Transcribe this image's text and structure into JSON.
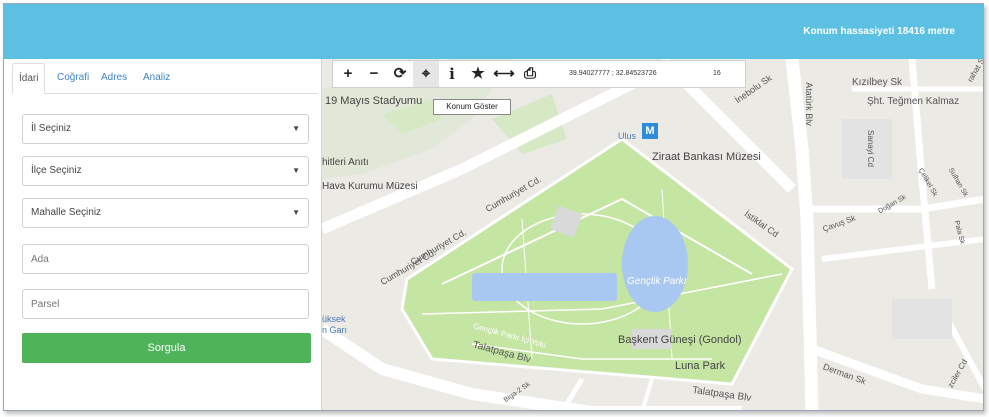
{
  "header": {
    "precision_text": "Konum hassasiyeti 18416 metre"
  },
  "tabs": [
    {
      "label": "İdari",
      "active": true
    },
    {
      "label": "Coğrafi"
    },
    {
      "label": "Adres"
    },
    {
      "label": "Analiz"
    }
  ],
  "form": {
    "province": "İl Seçiniz",
    "district": "İlçe Seçiniz",
    "neighborhood": "Mahalle Seçiniz",
    "block_placeholder": "Ada",
    "parcel_placeholder": "Parsel",
    "query_button": "Sorgula"
  },
  "toolbar": {
    "zoom_in": "+",
    "zoom_out": "−",
    "refresh": "⟳",
    "locate": "⌖",
    "info": "i",
    "favorite": "★",
    "measure": "⟷",
    "print": "⎙",
    "coordinates": "39.94027777 ; 32.84523726",
    "zoom_level": "16",
    "tooltip": "Konum Göster"
  },
  "map_labels": {
    "stadium": "19 Mayıs Stadyumu",
    "monument": "hitleri Anıtı",
    "aviation_museum": "Hava Kurumu Müzesi",
    "cumhuriyet_1": "Cumhuriyet Cd.",
    "cumhuriyet_2": "Cumhuriyet Cd.",
    "cumhuriyet_3": "Cumhuriyet Cd.",
    "ulus": "Ulus",
    "metro": "M",
    "ziraat": "Ziraat Bankası Müzesi",
    "istiklal": "İstiklal Cd",
    "genclik": "Gençlik Parkı",
    "genclik_road": "Gençlik Parkı İçi Yolu",
    "talatpasa_1": "Talatpaşa Blv",
    "talatpasa_2": "Talatpaşa Blv",
    "baskent": "Başkent Güneşi (Gondol)",
    "luna": "Luna Park",
    "train_top": "üksek",
    "train_bottom": "n Garı",
    "inebolu": "İnebolu Sk",
    "ataturk": "Atatürk Blv",
    "kizilbey": "Kızılbey Sk",
    "teğmen": "Şht. Teğmen Kalmaz",
    "sanayi": "Sanayi Cd",
    "cavus": "Çavuş Sk",
    "dogan": "Doğan Sk",
    "celikel": "Çelikel Sk",
    "sultan": "Sulhan Sk",
    "pala": "Pala Sk",
    "derman": "Derman Sk",
    "biga": "Biga-2 Sk",
    "ozciler": "zciler Cd",
    "rahat": "rahat Sk"
  },
  "colors": {
    "header": "#5cc0e3",
    "button": "#4fb35a",
    "park": "#c5e5a3",
    "water": "#a8c8f2",
    "road": "#ffffff",
    "map_bg": "#eceae5"
  }
}
